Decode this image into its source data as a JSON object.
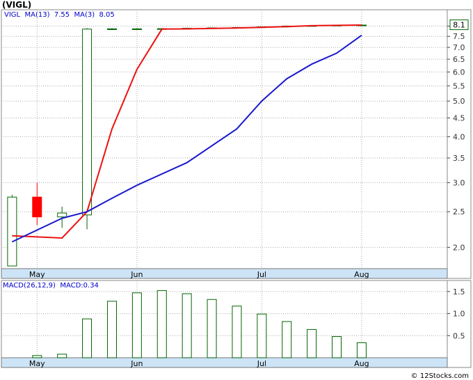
{
  "title": "(VIGL)",
  "watermark": "© 12Stocks.com",
  "colors": {
    "up": "#006400",
    "down": "#ff0000",
    "ma_long": "#1a1acd",
    "ma_short": "#ee1111",
    "axis_band": "#cde4f7",
    "legend_text": "#0000cc",
    "grid": "#aaaaaa",
    "macd_bar": "#006400"
  },
  "chart_data": [
    {
      "type": "candlestick",
      "scale": "log",
      "ylim": [
        1.75,
        8.3
      ],
      "xlim": [
        "2025-04-25",
        "2025-08-28"
      ],
      "grid": true,
      "legend": {
        "symbol": "VIGL",
        "ma13_label": "MA(13)",
        "ma13_value": "7.55",
        "ma3_label": "MA(3)",
        "ma3_value": "8.05"
      },
      "last_price_label": "8.1",
      "x_ticks": [
        {
          "label": "May",
          "date": "2025-05-05"
        },
        {
          "label": "Jun",
          "date": "2025-06-02"
        },
        {
          "label": "Jul",
          "date": "2025-07-07"
        },
        {
          "label": "Aug",
          "date": "2025-08-04"
        }
      ],
      "y_ticks": [
        {
          "label": "2.0",
          "value": 2.0
        },
        {
          "label": "2.5",
          "value": 2.5
        },
        {
          "label": "3.0",
          "value": 3.0
        },
        {
          "label": "3.5",
          "value": 3.5
        },
        {
          "label": "4.0",
          "value": 4.0
        },
        {
          "label": "4.5",
          "value": 4.5
        },
        {
          "label": "5.0",
          "value": 5.0
        },
        {
          "label": "5.5",
          "value": 5.5
        },
        {
          "label": "6.0",
          "value": 6.0
        },
        {
          "label": "6.5",
          "value": 6.5
        },
        {
          "label": "7.0",
          "value": 7.0
        },
        {
          "label": "7.5",
          "value": 7.5
        },
        {
          "label": "8.0",
          "value": 8.0
        }
      ],
      "candles": [
        {
          "date": "2025-04-28",
          "open": 1.78,
          "high": 2.78,
          "low": 1.78,
          "close": 2.74
        },
        {
          "date": "2025-05-05",
          "open": 2.74,
          "high": 3.0,
          "low": 2.3,
          "close": 2.42
        },
        {
          "date": "2025-05-12",
          "open": 2.42,
          "high": 2.58,
          "low": 2.26,
          "close": 2.48
        },
        {
          "date": "2025-05-19",
          "open": 2.45,
          "high": 7.9,
          "low": 2.24,
          "close": 7.85
        },
        {
          "date": "2025-05-26",
          "open": 7.85,
          "high": 7.9,
          "low": 7.84,
          "close": 7.86
        },
        {
          "date": "2025-06-02",
          "open": 7.86,
          "high": 7.9,
          "low": 7.84,
          "close": 7.86
        },
        {
          "date": "2025-06-09",
          "open": 7.86,
          "high": 7.9,
          "low": 7.84,
          "close": 7.87
        },
        {
          "date": "2025-06-16",
          "open": 7.87,
          "high": 7.92,
          "low": 7.85,
          "close": 7.89
        },
        {
          "date": "2025-06-23",
          "open": 7.89,
          "high": 7.93,
          "low": 7.87,
          "close": 7.91
        },
        {
          "date": "2025-06-30",
          "open": 7.91,
          "high": 7.95,
          "low": 7.89,
          "close": 7.93
        },
        {
          "date": "2025-07-07",
          "open": 7.93,
          "high": 7.98,
          "low": 7.91,
          "close": 7.96
        },
        {
          "date": "2025-07-14",
          "open": 7.96,
          "high": 8.02,
          "low": 7.94,
          "close": 8.0
        },
        {
          "date": "2025-07-21",
          "open": 8.0,
          "high": 8.04,
          "low": 7.98,
          "close": 8.02
        },
        {
          "date": "2025-07-28",
          "open": 8.02,
          "high": 8.06,
          "low": 8.0,
          "close": 8.04
        },
        {
          "date": "2025-08-04",
          "open": 8.04,
          "high": 8.08,
          "low": 8.02,
          "close": 8.05
        }
      ],
      "ma13": [
        {
          "date": "2025-04-28",
          "value": 2.07
        },
        {
          "date": "2025-05-12",
          "value": 2.4
        },
        {
          "date": "2025-05-19",
          "value": 2.5
        },
        {
          "date": "2025-05-26",
          "value": 2.72
        },
        {
          "date": "2025-06-02",
          "value": 2.95
        },
        {
          "date": "2025-06-16",
          "value": 3.4
        },
        {
          "date": "2025-06-30",
          "value": 4.2
        },
        {
          "date": "2025-07-07",
          "value": 5.0
        },
        {
          "date": "2025-07-14",
          "value": 5.75
        },
        {
          "date": "2025-07-21",
          "value": 6.3
        },
        {
          "date": "2025-07-28",
          "value": 6.75
        },
        {
          "date": "2025-08-04",
          "value": 7.55
        }
      ],
      "ma3": [
        {
          "date": "2025-04-28",
          "value": 2.15
        },
        {
          "date": "2025-05-12",
          "value": 2.12
        },
        {
          "date": "2025-05-19",
          "value": 2.5
        },
        {
          "date": "2025-05-26",
          "value": 4.2
        },
        {
          "date": "2025-06-02",
          "value": 6.1
        },
        {
          "date": "2025-06-09",
          "value": 7.85
        },
        {
          "date": "2025-06-16",
          "value": 7.86
        },
        {
          "date": "2025-06-30",
          "value": 7.9
        },
        {
          "date": "2025-07-14",
          "value": 7.97
        },
        {
          "date": "2025-07-21",
          "value": 8.02
        },
        {
          "date": "2025-08-04",
          "value": 8.05
        }
      ]
    },
    {
      "type": "bar",
      "ylim": [
        0,
        1.75
      ],
      "grid": true,
      "legend": {
        "label": "MACD(26,12,9)",
        "value_label": "MACD:0.34"
      },
      "x_ticks": [
        {
          "label": "May",
          "date": "2025-05-05"
        },
        {
          "label": "Jun",
          "date": "2025-06-02"
        },
        {
          "label": "Jul",
          "date": "2025-07-07"
        },
        {
          "label": "Aug",
          "date": "2025-08-04"
        }
      ],
      "y_ticks": [
        {
          "label": "0.5",
          "value": 0.5
        },
        {
          "label": "1.0",
          "value": 1.0
        },
        {
          "label": "1.5",
          "value": 1.5
        }
      ],
      "bars": [
        {
          "date": "2025-05-05",
          "value": 0.05
        },
        {
          "date": "2025-05-12",
          "value": 0.08
        },
        {
          "date": "2025-05-19",
          "value": 0.88
        },
        {
          "date": "2025-05-26",
          "value": 1.28
        },
        {
          "date": "2025-06-02",
          "value": 1.47
        },
        {
          "date": "2025-06-09",
          "value": 1.52
        },
        {
          "date": "2025-06-16",
          "value": 1.45
        },
        {
          "date": "2025-06-23",
          "value": 1.32
        },
        {
          "date": "2025-06-30",
          "value": 1.17
        },
        {
          "date": "2025-07-07",
          "value": 0.99
        },
        {
          "date": "2025-07-14",
          "value": 0.82
        },
        {
          "date": "2025-07-21",
          "value": 0.64
        },
        {
          "date": "2025-07-28",
          "value": 0.48
        },
        {
          "date": "2025-08-04",
          "value": 0.34
        }
      ]
    }
  ]
}
